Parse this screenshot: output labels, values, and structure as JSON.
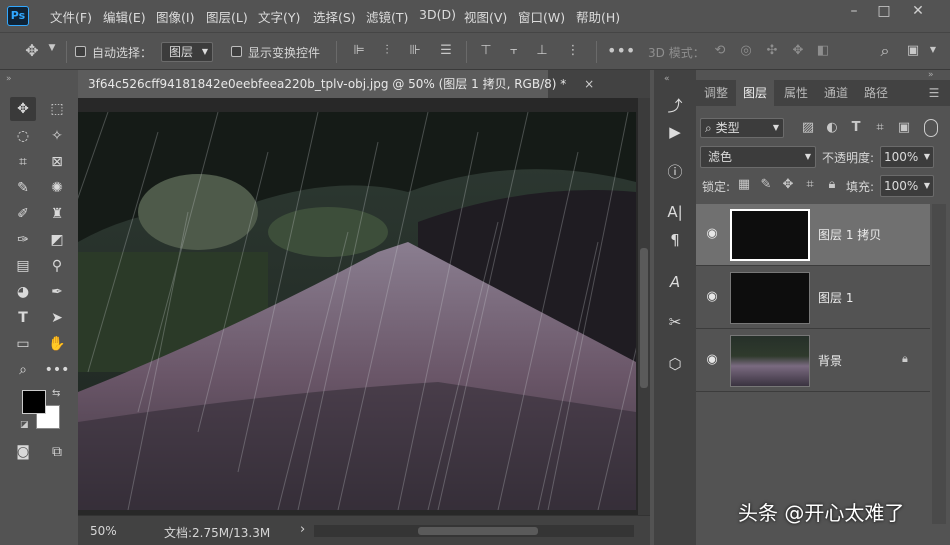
{
  "app": {
    "logo": "Ps"
  },
  "menu": [
    "文件(F)",
    "编辑(E)",
    "图像(I)",
    "图层(L)",
    "文字(Y)",
    "选择(S)",
    "滤镜(T)",
    "3D(D)",
    "视图(V)",
    "窗口(W)",
    "帮助(H)"
  ],
  "window_controls": {
    "minimize": "–",
    "maximize": "□",
    "close": "✕"
  },
  "options": {
    "auto_select_label": "自动选择：",
    "auto_select_value": "图层",
    "show_transform_label": "显示变换控件",
    "mode_3d_label": "3D 模式："
  },
  "document": {
    "tab_title": "3f64c526cff94181842e0eebfeea220b_tplv-obj.jpg @ 50% (图层 1 拷贝, RGB/8) *",
    "close": "×",
    "zoom": "50%",
    "doc_info": "文档:2.75M/13.3M",
    "arrow": "›"
  },
  "panel": {
    "tabs": [
      "调整",
      "图层",
      "属性",
      "通道",
      "路径"
    ],
    "active_tab": "图层",
    "filter_kind": "类型",
    "blend_mode": "滤色",
    "opacity_label": "不透明度:",
    "opacity_value": "100%",
    "lock_label": "锁定:",
    "fill_label": "填充:",
    "fill_value": "100%",
    "layers": [
      {
        "name": "图层 1 拷贝",
        "selected": true,
        "locked": false
      },
      {
        "name": "图层 1",
        "selected": false,
        "locked": false
      },
      {
        "name": "背景",
        "selected": false,
        "locked": true
      }
    ]
  },
  "watermark": "头条 @开心太难了",
  "colors": {
    "accent": "#31a8ff",
    "ui_bg": "#535353",
    "dark": "#282828"
  }
}
